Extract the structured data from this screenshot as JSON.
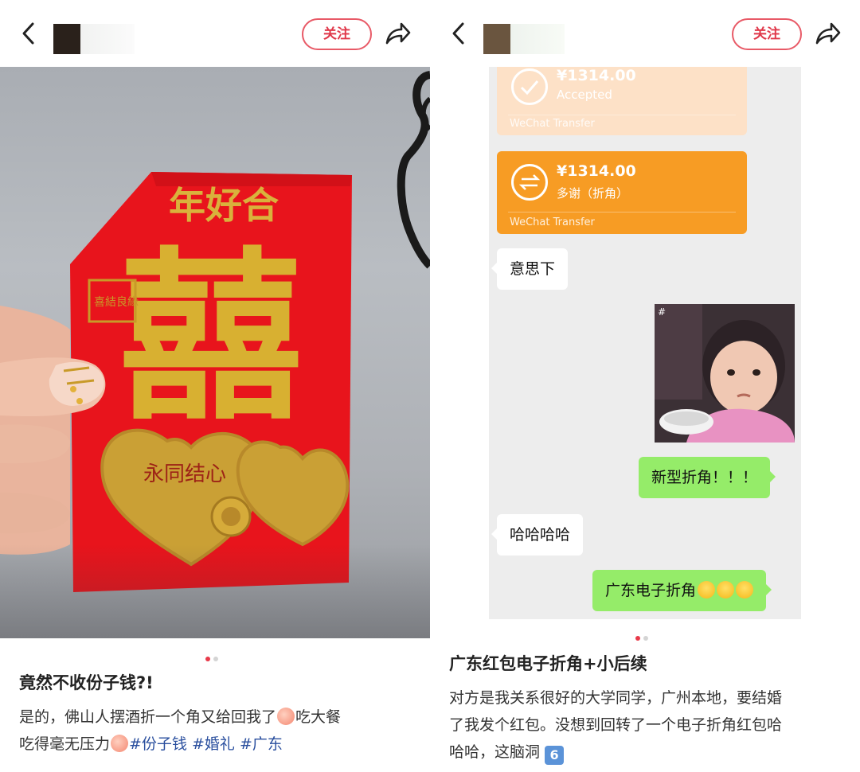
{
  "left": {
    "follow_label": "关注",
    "title": "竟然不收份子钱?!",
    "desc": {
      "text1": "是的，佛山人摆酒折一个角又给回我了",
      "text2": "吃大餐",
      "text3": "吃得毫无压力",
      "tags": [
        "#份子钱",
        "#婚礼",
        "#广东"
      ]
    },
    "envelope": {
      "top_text": "年好合",
      "double_happiness": "囍",
      "stamp": "喜結良緣",
      "heart_text": "永同结心"
    }
  },
  "right": {
    "follow_label": "关注",
    "transfers": [
      {
        "amount": "¥1314.00",
        "note": "Accepted",
        "brand": "WeChat Transfer",
        "color": "#fde1c7"
      },
      {
        "amount": "¥1314.00",
        "note": "多谢（折角）",
        "brand": "WeChat Transfer",
        "color": "#f79c24"
      }
    ],
    "messages": [
      {
        "side": "left",
        "text": "意思下"
      },
      {
        "side": "right",
        "text": "新型折角！！！"
      },
      {
        "side": "left",
        "text": "哈哈哈哈"
      },
      {
        "side": "right",
        "text": "广东电子折角"
      }
    ],
    "title": "广东红包电子折角+小后续",
    "desc": {
      "line1": "对方是我关系很好的大学同学，广州本地，要结婚",
      "line2": "了我发个红包。没想到回转了一个电子折角红包哈",
      "line3": "哈哈，这脑洞",
      "emoji_six": "6"
    }
  },
  "colors": {
    "accent": "#e83a4a",
    "wechat_green": "#95ec69",
    "transfer_orange": "#f79c24",
    "tag_blue": "#2a4f9e"
  },
  "icons": [
    "back-arrow-icon",
    "share-icon",
    "check-circle-icon",
    "transfer-arrows-icon",
    "peach-emoji-icon",
    "laugh-cry-emoji-icon",
    "keycap-six-icon"
  ]
}
